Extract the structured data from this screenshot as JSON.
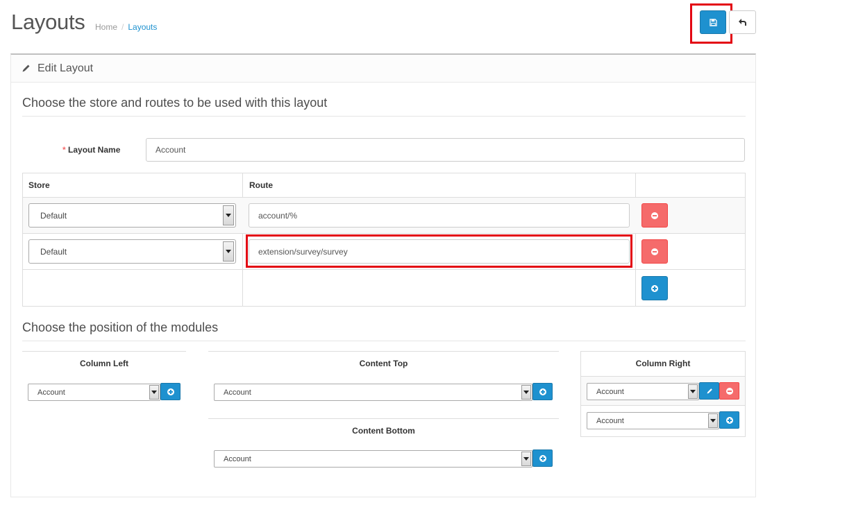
{
  "header": {
    "title": "Layouts",
    "breadcrumb": [
      {
        "label": "Home"
      },
      {
        "label": "Layouts"
      }
    ]
  },
  "toolbar": {
    "save_icon": "floppy-disk-icon",
    "back_icon": "reply-icon"
  },
  "panel": {
    "heading": "Edit Layout",
    "heading_icon": "pencil-icon"
  },
  "sections": {
    "routes_legend": "Choose the store and routes to be used with this layout",
    "modules_legend": "Choose the position of the modules"
  },
  "form": {
    "layout_name_required": "*",
    "layout_name_label": "Layout Name",
    "layout_name_value": "Account"
  },
  "route_table": {
    "headers": {
      "store": "Store",
      "route": "Route"
    },
    "rows": [
      {
        "store": "Default",
        "route": "account/%"
      },
      {
        "store": "Default",
        "route": "extension/survey/survey"
      }
    ]
  },
  "positions": {
    "column_left": {
      "label": "Column Left",
      "selected": "Account"
    },
    "content_top": {
      "label": "Content Top",
      "selected": "Account"
    },
    "content_bottom": {
      "label": "Content Bottom",
      "selected": "Account"
    },
    "column_right": {
      "label": "Column Right",
      "rows": [
        {
          "module": "Account"
        },
        {
          "selected": "Account"
        }
      ]
    }
  },
  "colors": {
    "primary": "#1e91cf",
    "danger": "#f56b6b",
    "highlight": "#e30613"
  }
}
